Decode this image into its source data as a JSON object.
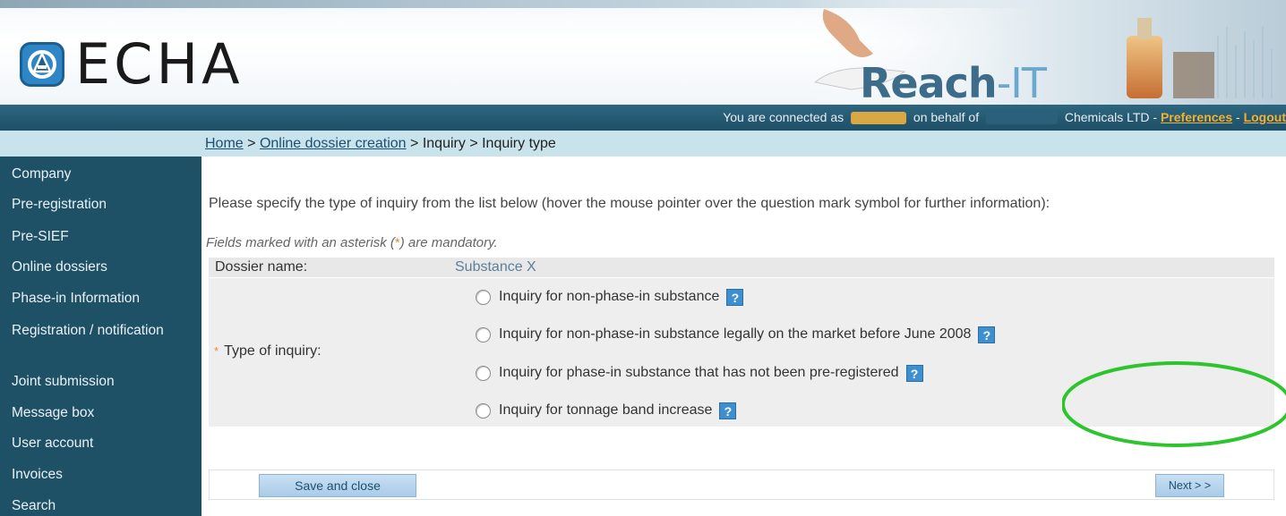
{
  "header": {
    "logo_text": "ECHA",
    "product_name_main": "Reach",
    "product_name_suffix": "-IT"
  },
  "status": {
    "prefix": "You are connected as",
    "middle": "on behalf of",
    "company_suffix": "Chemicals LTD -",
    "preferences": "Preferences",
    "separator": "-",
    "logout": "Logout"
  },
  "breadcrumb": {
    "home": "Home",
    "sep": ">",
    "online_dossier": "Online dossier creation",
    "inquiry": "Inquiry",
    "current": "Inquiry type"
  },
  "sidebar": {
    "items": [
      {
        "label": "Company"
      },
      {
        "label": "Pre-registration"
      },
      {
        "label": "Pre-SIEF"
      },
      {
        "label": "Online dossiers"
      },
      {
        "label": "Phase-in Information"
      },
      {
        "label": "Registration / notification"
      },
      {
        "label": "Joint submission"
      },
      {
        "label": "Message box"
      },
      {
        "label": "User account"
      },
      {
        "label": "Invoices"
      },
      {
        "label": "Search"
      }
    ]
  },
  "main": {
    "instruction": "Please specify the type of inquiry from the list below (hover the mouse pointer over the question mark symbol for further information):",
    "mandatory_prefix": "Fields marked with an asterisk (",
    "mandatory_ast": "*",
    "mandatory_suffix": ") are mandatory.",
    "dossier_label": "Dossier name:",
    "dossier_value": "Substance X",
    "type_ast": "*",
    "type_label": "Type of inquiry:",
    "options": [
      {
        "label": "Inquiry for non-phase-in substance",
        "selected": false
      },
      {
        "label": "Inquiry for non-phase-in substance legally on the market before June 2008",
        "selected": false
      },
      {
        "label": "Inquiry for phase-in substance that has not been pre-registered",
        "selected": false
      },
      {
        "label": "Inquiry for tonnage band increase",
        "selected": false
      }
    ],
    "help_glyph": "?",
    "save_label": "Save and close",
    "next_label": "Next > >"
  },
  "colors": {
    "sidebar_bg": "#1f5166",
    "statusbar_bg": "#1e4f66",
    "breadcrumb_bg": "#c8e3ec",
    "link_highlight": "#f2b134",
    "annotation": "#2ec42e"
  }
}
